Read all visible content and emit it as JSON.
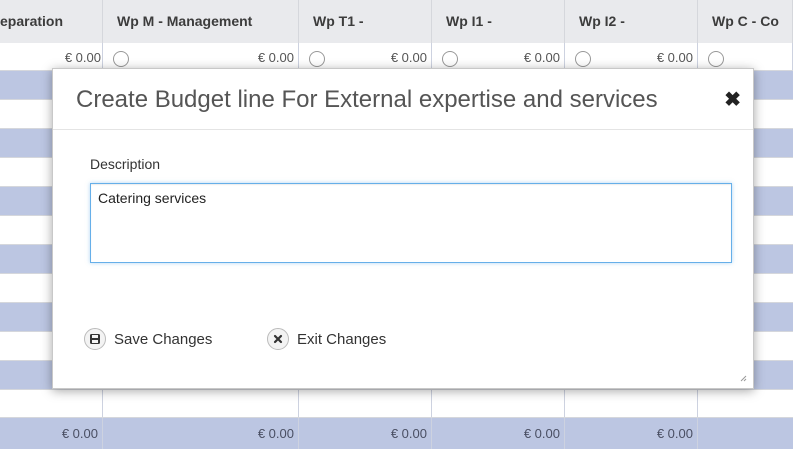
{
  "table": {
    "headers": [
      "eparation",
      "Wp M - Management",
      "Wp T1 -",
      "Wp I1 -",
      "Wp I2 -",
      "Wp C - Co"
    ],
    "first_row_values": [
      "€ 0.00",
      "€ 0.00",
      "€ 0.00",
      "€ 0.00",
      "€ 0.00"
    ],
    "total_row_values": [
      "€ 0.00",
      "€ 0.00",
      "€ 0.00",
      "€ 0.00",
      "€ 0.00"
    ]
  },
  "modal": {
    "title": "Create Budget line For External expertise and services",
    "close_symbol": "✖",
    "description_label": "Description",
    "description_value": "Catering services",
    "save_label": "Save Changes",
    "exit_label": "Exit Changes"
  },
  "colors": {
    "row_shade": "#bcc6e2",
    "header_bg": "#e9eaed",
    "focus_border": "#66afe9"
  }
}
